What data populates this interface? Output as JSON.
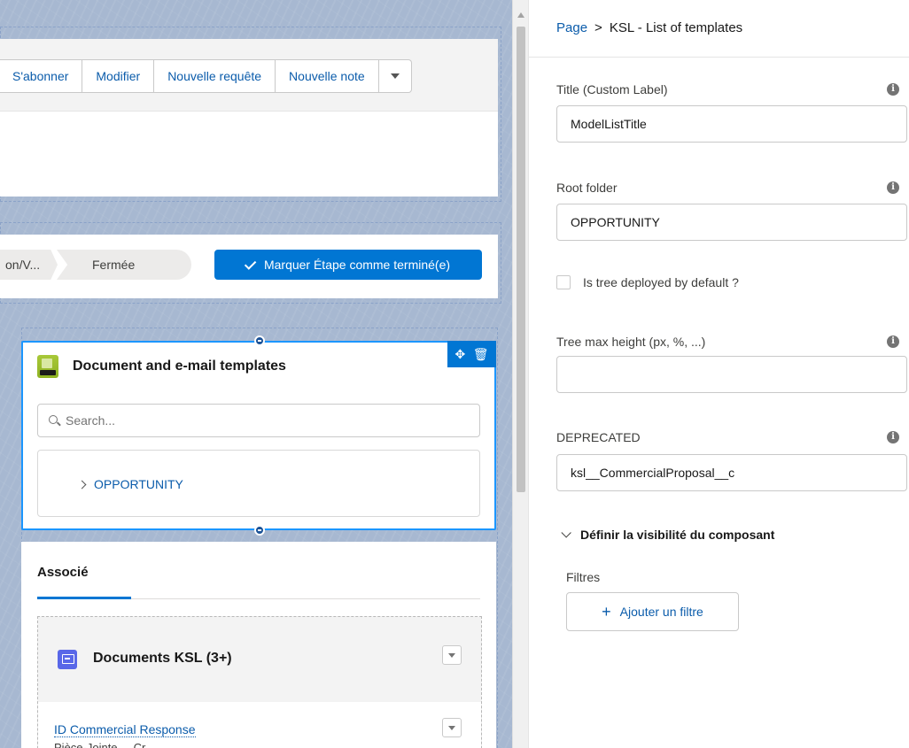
{
  "toolbar": {
    "buttons": [
      "S'abonner",
      "Modifier",
      "Nouvelle requête",
      "Nouvelle note"
    ]
  },
  "path": {
    "previous_stage": "on/V...",
    "closed_stage": "Fermée",
    "mark_complete_label": "Marquer Étape comme terminé(e)"
  },
  "component": {
    "title": "Document and e-mail templates",
    "search_placeholder": "Search...",
    "tree_root": "OPPORTUNITY"
  },
  "related": {
    "tab_label": "Associé",
    "docs_title": "Documents KSL (3+)",
    "first_record": "ID Commercial Response",
    "first_record_sub": "Pièce-Jointe ... Cr..."
  },
  "panel": {
    "breadcrumb": {
      "page": "Page",
      "separator": ">",
      "current": "KSL - List of templates"
    },
    "fields": {
      "title_label": "Title (Custom Label)",
      "title_value": "ModelListTitle",
      "root_label": "Root folder",
      "root_value": "OPPORTUNITY",
      "tree_deployed_label": "Is tree deployed by default ?",
      "max_height_label": "Tree max height (px, %, ...)",
      "max_height_value": "",
      "deprecated_label": "DEPRECATED",
      "deprecated_value": "ksl__CommercialProposal__c"
    },
    "visibility": {
      "heading": "Définir la visibilité du composant",
      "filters_label": "Filtres",
      "add_filter_label": "Ajouter un filtre"
    }
  },
  "colors": {
    "brand": "#0176d3",
    "link": "#0b5cab",
    "canvas": "#a7b8d1",
    "selection": "#1b96ff"
  }
}
